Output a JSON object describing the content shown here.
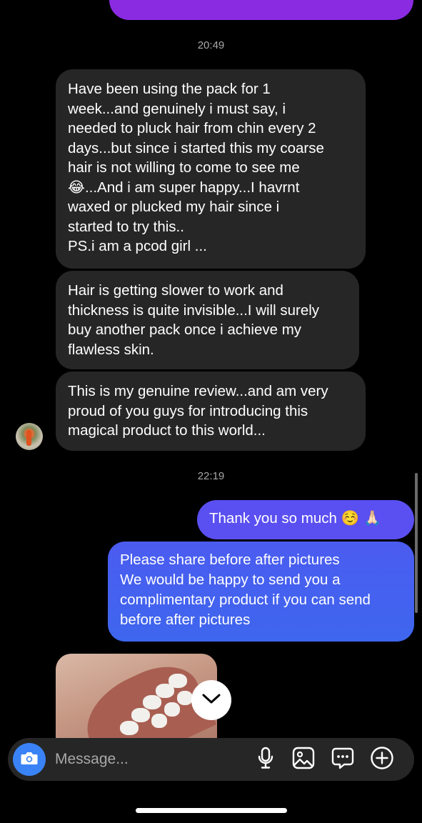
{
  "colors": {
    "background": "#000000",
    "incoming_bubble": "#262626",
    "outgoing_bubble_start": "#5b4ff0",
    "outgoing_bubble_end": "#3f63ee",
    "previous_bubble": "#8a2be2",
    "camera_button": "#3a83f6",
    "timestamp": "#a8a8a8"
  },
  "conversation": {
    "timestamps": [
      "20:49",
      "22:19"
    ],
    "incoming_messages": [
      "Have been using the pack for 1\nweek...and genuinely i must say, i\nneeded to pluck hair from chin every 2\ndays...but since i started this my coarse\nhair is not willing to come to see me\n😂...And i am super happy...I havrnt\nwaxed or plucked my hair since i\nstarted to try this..\nPS.i am a pcod girl ...",
      "Hair is getting slower to work and\nthickness is quite invisible...I will surely\nbuy another pack once i achieve my\nflawless skin.",
      "This is my genuine review...and am very\nproud of you guys for introducing this\nmagical product to this world..."
    ],
    "outgoing_messages": [
      "Thank you so much ☺️ 🙏🏻",
      "Please share before after pictures\nWe would be happy to send you a\ncomplimentary product if you can send\nbefore after pictures"
    ]
  },
  "composer": {
    "placeholder": "Message...",
    "icons": [
      "camera-icon",
      "microphone-icon",
      "gallery-icon",
      "sticker-icon",
      "add-icon"
    ]
  },
  "scroll_down_icon": "chevron-down-icon"
}
